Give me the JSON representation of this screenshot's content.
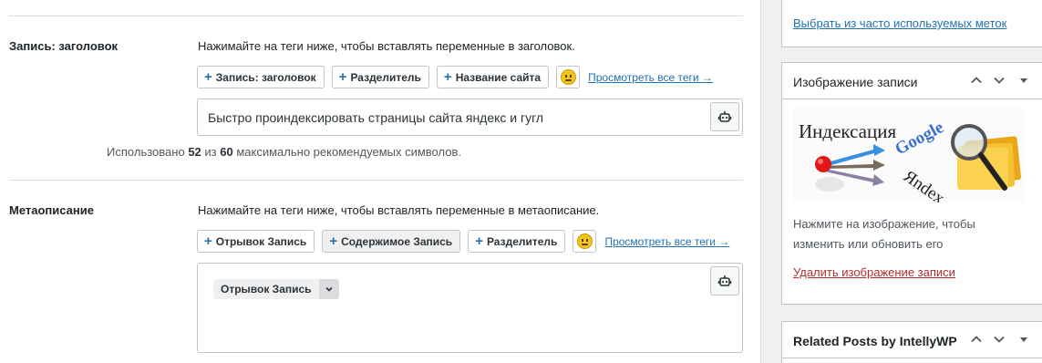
{
  "title_section": {
    "label": "Запись: заголовок",
    "hint": "Нажимайте на теги ниже, чтобы вставлять переменные в заголовок.",
    "tags": [
      "Запись: заголовок",
      "Разделитель",
      "Название сайта"
    ],
    "all_tags_link": "Просмотреть все теги →",
    "input_value": "Быстро проиндексировать страницы сайта яндекс и гугл",
    "counter_prefix": "Использовано",
    "counter_used": "52",
    "counter_mid": "из",
    "counter_max": "60",
    "counter_suffix": "максимально рекомендуемых символов."
  },
  "meta_section": {
    "label": "Метаописание",
    "hint": "Нажимайте на теги ниже, чтобы вставлять переменные в метаописание.",
    "tags": [
      "Отрывок Запись",
      "Содержимое Запись",
      "Разделитель"
    ],
    "all_tags_link": "Просмотреть все теги →",
    "chip_label": "Отрывок Запись"
  },
  "sidebar": {
    "tags_panel": {
      "link": "Выбрать из часто используемых меток"
    },
    "featured_image": {
      "title": "Изображение записи",
      "image_text_main": "Индексация",
      "image_text_google": "Google",
      "image_text_yandex": "Яndex",
      "hint": "Нажмите на изображение, чтобы изменить или обновить его",
      "remove_link": "Удалить изображение записи"
    },
    "related_posts": {
      "title": "Related Posts by IntellyWP"
    }
  },
  "colors": {
    "link": "#2271b1",
    "danger": "#b32d2e",
    "border": "#c3c4c7"
  }
}
